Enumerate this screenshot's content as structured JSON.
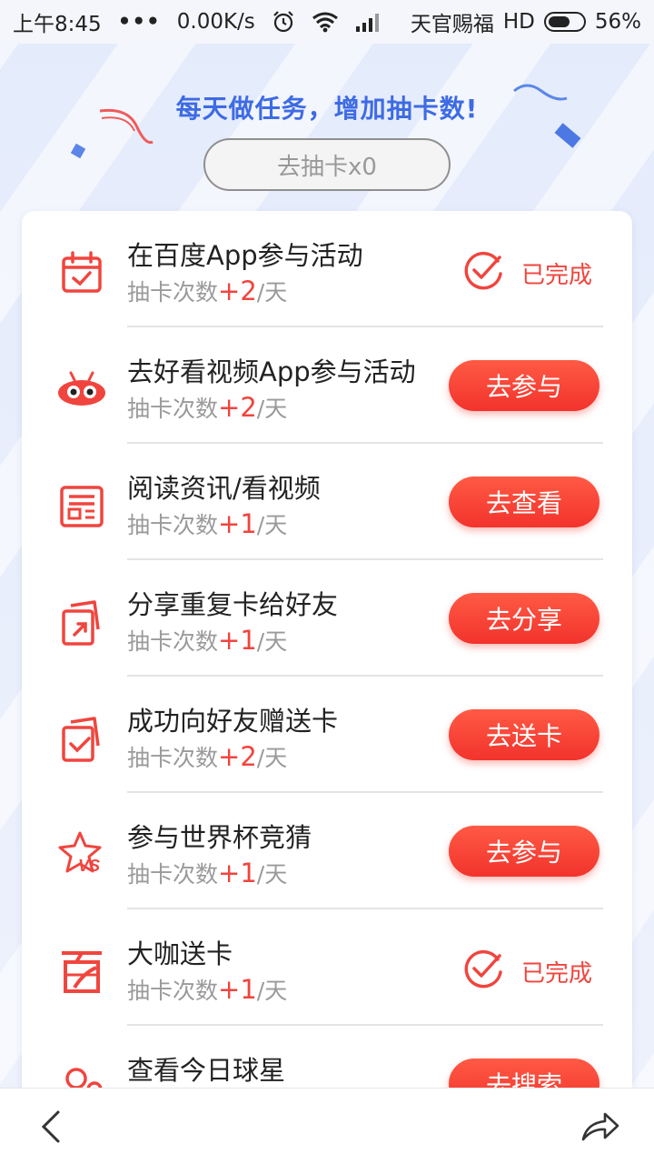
{
  "status_bar": {
    "time": "上午8:45",
    "dots": "•••",
    "net_speed": "0.00K/s",
    "carrier": "天官赐福",
    "hd": "HD",
    "battery": "56%",
    "icons": [
      "alarm-icon",
      "wifi-icon",
      "signal-icon",
      "battery-icon"
    ]
  },
  "header": {
    "subtitle": "每天做任务，增加抽卡数!",
    "draw_button": "去抽卡x0"
  },
  "common": {
    "sub_prefix": "抽卡次数",
    "sub_suffix": "/天"
  },
  "tasks": [
    {
      "icon": "calendar-icon",
      "title": "在百度App参与活动",
      "count": "+2",
      "status": "done",
      "status_label": "已完成"
    },
    {
      "icon": "haokan-eyes-icon",
      "title": "去好看视频App参与活动",
      "count": "+2",
      "status": "action",
      "action_label": "去参与"
    },
    {
      "icon": "news-icon",
      "title": "阅读资讯/看视频",
      "count": "+1",
      "status": "action",
      "action_label": "去查看"
    },
    {
      "icon": "share-card-icon",
      "title": "分享重复卡给好友",
      "count": "+1",
      "status": "action",
      "action_label": "去分享"
    },
    {
      "icon": "gift-card-icon",
      "title": "成功向好友赠送卡",
      "count": "+2",
      "status": "action",
      "action_label": "去送卡"
    },
    {
      "icon": "vs-star-icon",
      "title": "参与世界杯竞猜",
      "count": "+1",
      "status": "action",
      "action_label": "去参与"
    },
    {
      "icon": "baijiahao-icon",
      "title": "大咖送卡",
      "count": "+1",
      "status": "done",
      "status_label": "已完成"
    },
    {
      "icon": "star-player-icon",
      "title": "查看今日球星",
      "count": "",
      "status": "action",
      "action_label": "去搜索"
    }
  ],
  "colors": {
    "accent_red": "#f0453e",
    "title_blue": "#2f5fe3"
  }
}
